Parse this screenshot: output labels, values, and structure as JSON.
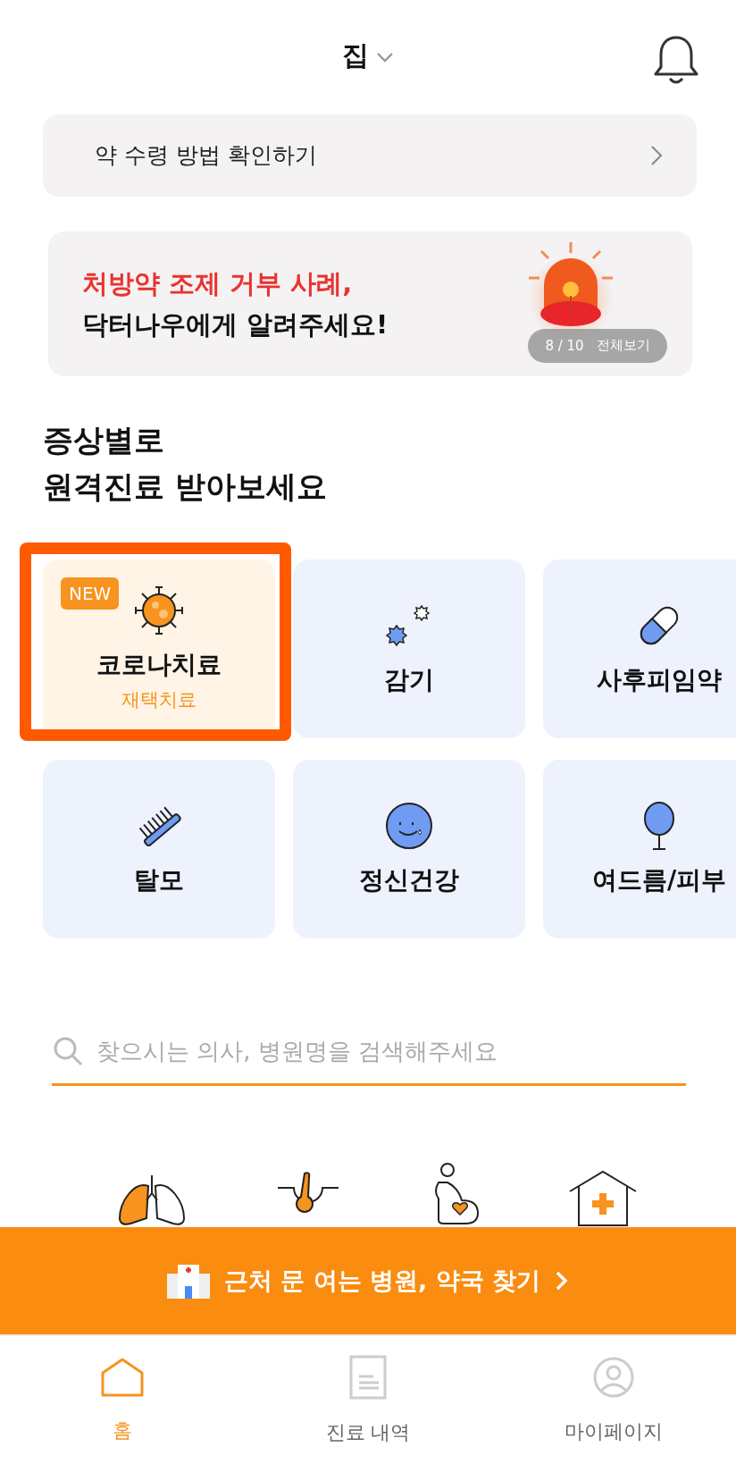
{
  "header": {
    "location": "집"
  },
  "info_bar": {
    "label": "약 수령 방법 확인하기"
  },
  "banner": {
    "lines": [
      {
        "text": "처방약 조제 거부 사례,",
        "color": "#e8332f"
      },
      {
        "text": "닥터나우에게 알려주세요!",
        "color": "#111111"
      }
    ],
    "counter": "8 / 10",
    "view_all": "전체보기"
  },
  "section_title": [
    "증상별로",
    "원격진료 받아보세요"
  ],
  "categories": [
    {
      "label": "코로나치료",
      "sublabel": "재택치료",
      "badge": "NEW",
      "selected": true,
      "annotated": true
    },
    {
      "label": "감기",
      "selected": false,
      "annotated": false
    },
    {
      "label": "사후피임약",
      "selected": false,
      "annotated": false
    },
    {
      "label": "탈모",
      "selected": false,
      "annotated": false
    },
    {
      "label": "정신건강",
      "selected": false,
      "annotated": false
    },
    {
      "label": "여드름/피부",
      "selected": false,
      "annotated": false
    }
  ],
  "search": {
    "placeholder": "찾으시는 의사, 병원명을 검색해주세요"
  },
  "cta": {
    "label": "근처 문 여는 병원, 약국 찾기"
  },
  "nav": [
    {
      "label": "홈",
      "selected": true
    },
    {
      "label": "진료 내역",
      "selected": false
    },
    {
      "label": "마이페이지",
      "selected": false
    }
  ]
}
